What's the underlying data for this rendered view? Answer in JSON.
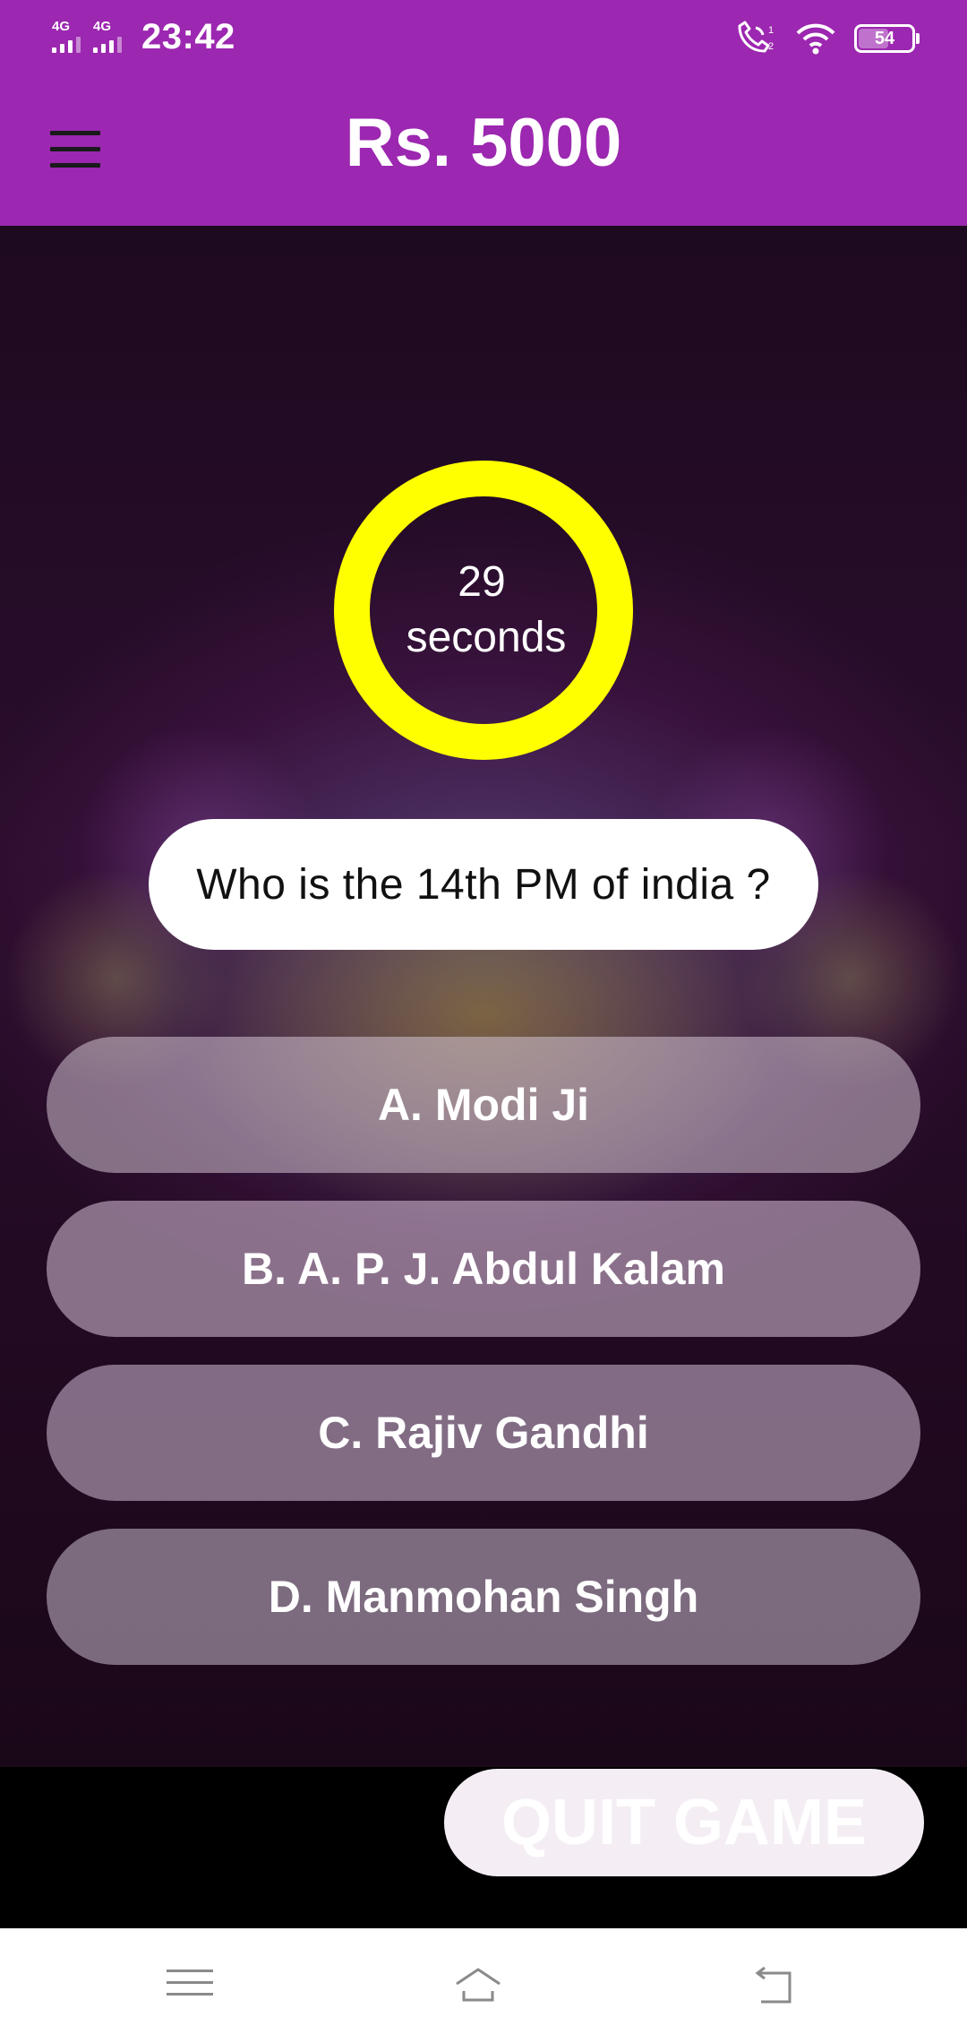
{
  "status_bar": {
    "sim1_tag": "4G",
    "sim2_tag": "4G",
    "time": "23:42",
    "battery": "54",
    "icons": [
      "signal-icon",
      "signal-icon",
      "call-icon",
      "wifi-icon",
      "battery-icon"
    ]
  },
  "app_bar": {
    "title": "Rs. 5000",
    "menu_icon": "hamburger-menu-icon"
  },
  "timer": {
    "value": "29",
    "unit": "seconds",
    "ring_color": "#ffff00"
  },
  "question": {
    "text": "Who is the 14th PM of india ?"
  },
  "options": [
    {
      "label": "A. Modi Ji"
    },
    {
      "label": "B. A. P. J. Abdul Kalam"
    },
    {
      "label": "C. Rajiv Gandhi"
    },
    {
      "label": "D. Manmohan Singh"
    }
  ],
  "quit_button": {
    "label": "QUIT GAME"
  },
  "nav_bar": {
    "icons": [
      "menu-icon",
      "home-icon",
      "back-icon"
    ]
  },
  "colors": {
    "accent": "#9c27b0",
    "timer": "#ffff00"
  }
}
